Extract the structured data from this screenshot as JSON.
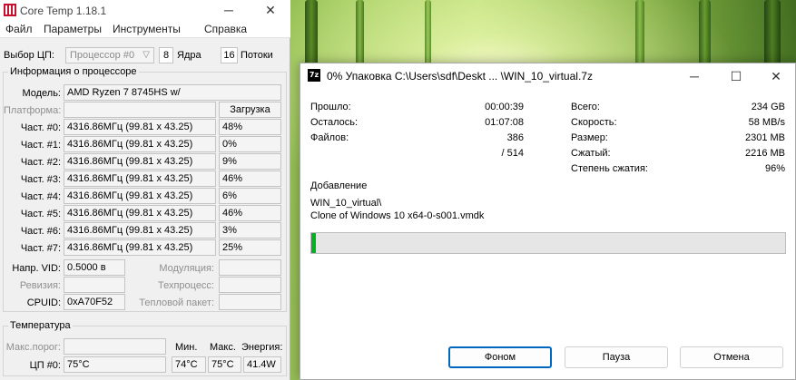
{
  "core_temp": {
    "title": "Core Temp 1.18.1",
    "menu": [
      "Файл",
      "Параметры",
      "Инструменты",
      "Справка"
    ],
    "cpu_select_label": "Выбор ЦП:",
    "cpu_select_value": "Процессор #0",
    "cores_count": "8",
    "cores_label": "Ядра",
    "threads_count": "16",
    "threads_label": "Потоки",
    "info_group_title": "Информация о процессоре",
    "model_label": "Модель:",
    "model_value": "AMD Ryzen 7 8745HS w/",
    "platform_label": "Платформа:",
    "load_header": "Загрузка",
    "cores": [
      {
        "label": "Част. #0:",
        "freq": "4316.86МГц (99.81 x 43.25)",
        "load": "48%"
      },
      {
        "label": "Част. #1:",
        "freq": "4316.86МГц (99.81 x 43.25)",
        "load": "0%"
      },
      {
        "label": "Част. #2:",
        "freq": "4316.86МГц (99.81 x 43.25)",
        "load": "9%"
      },
      {
        "label": "Част. #3:",
        "freq": "4316.86МГц (99.81 x 43.25)",
        "load": "46%"
      },
      {
        "label": "Част. #4:",
        "freq": "4316.86МГц (99.81 x 43.25)",
        "load": "6%"
      },
      {
        "label": "Част. #5:",
        "freq": "4316.86МГц (99.81 x 43.25)",
        "load": "46%"
      },
      {
        "label": "Част. #6:",
        "freq": "4316.86МГц (99.81 x 43.25)",
        "load": "3%"
      },
      {
        "label": "Част. #7:",
        "freq": "4316.86МГц (99.81 x 43.25)",
        "load": "25%"
      }
    ],
    "vid_label": "Напр. VID:",
    "vid_value": "0.5000 в",
    "modulation_label": "Модуляция:",
    "revision_label": "Ревизия:",
    "process_label": "Техпроцесс:",
    "cpuid_label": "CPUID:",
    "cpuid_value": "0xA70F52",
    "tdp_label": "Тепловой пакет:",
    "temp_group_title": "Температура",
    "tjmax_label": "Макс.порог:",
    "min_header": "Мин.",
    "max_header": "Макс.",
    "energy_header": "Энергия:",
    "cpu0_label": "ЦП #0:",
    "cpu0_temp": "75°C",
    "cpu0_min": "74°C",
    "cpu0_max": "75°C",
    "cpu0_energy": "41.4W"
  },
  "zip": {
    "title": "0% Упаковка C:\\Users\\sdf\\Deskt ... \\WIN_10_virtual.7z",
    "icon_text": "7z",
    "elapsed_label": "Прошло:",
    "elapsed_value": "00:00:39",
    "remaining_label": "Осталось:",
    "remaining_value": "01:07:08",
    "files_label": "Файлов:",
    "files_value": "386",
    "files_total": "/ 514",
    "total_label": "Всего:",
    "total_value": "234 GB",
    "speed_label": "Скорость:",
    "speed_value": "58 MB/s",
    "size_label": "Размер:",
    "size_value": "2301 MB",
    "compressed_label": "Сжатый:",
    "compressed_value": "2216 MB",
    "ratio_label": "Степень сжатия:",
    "ratio_value": "96%",
    "adding_label": "Добавление",
    "path_line1": "WIN_10_virtual\\",
    "path_line2": "Clone of Windows 10 x64-0-s001.vmdk",
    "progress_fraction": 0.01,
    "btn_background": "Фоном",
    "btn_pause": "Пауза",
    "btn_cancel": "Отмена",
    "progress_color": "#06b025",
    "accent_color": "#0067c0"
  }
}
